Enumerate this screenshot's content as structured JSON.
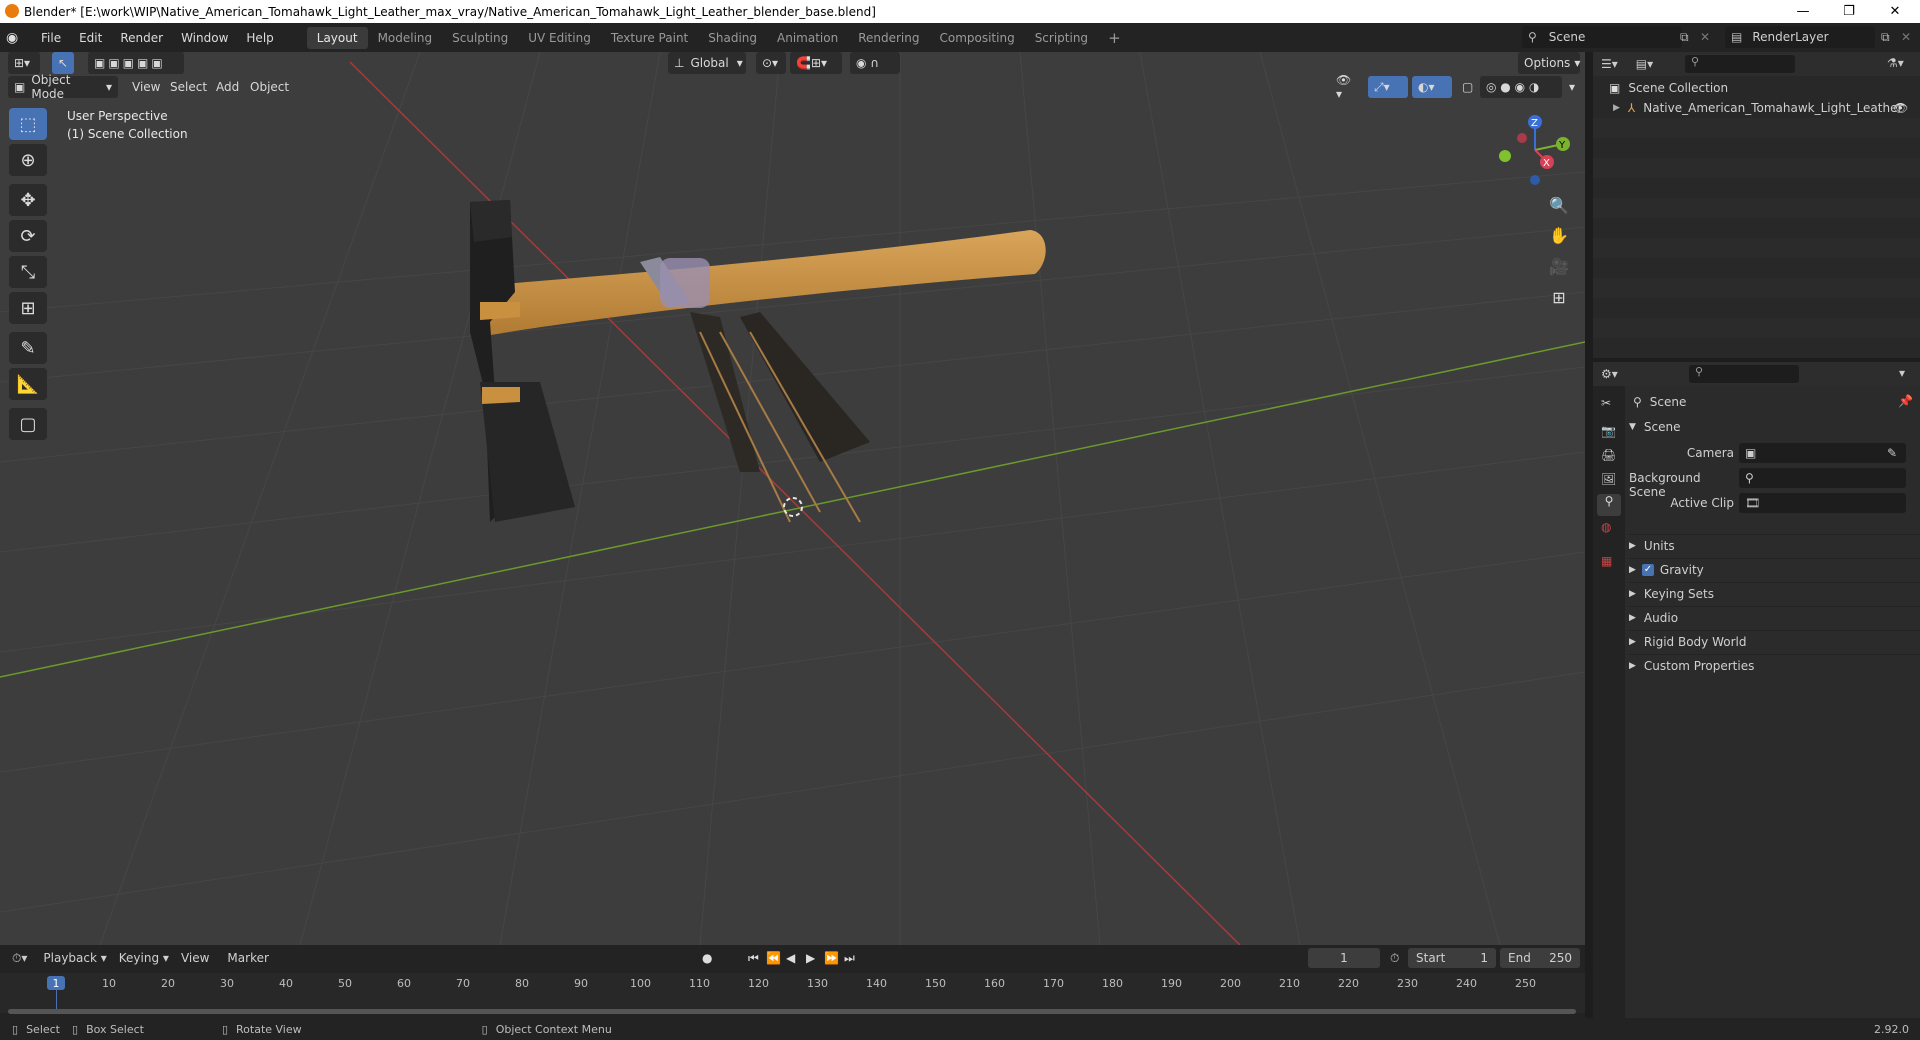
{
  "window": {
    "title": "Blender* [E:\\work\\WIP\\Native_American_Tomahawk_Light_Leather_max_vray/Native_American_Tomahawk_Light_Leather_blender_base.blend]",
    "minimize": "—",
    "maximize": "❐",
    "close": "✕"
  },
  "menubar": {
    "items": [
      "File",
      "Edit",
      "Render",
      "Window",
      "Help"
    ],
    "workspaces": [
      "Layout",
      "Modeling",
      "Sculpting",
      "UV Editing",
      "Texture Paint",
      "Shading",
      "Animation",
      "Rendering",
      "Compositing",
      "Scripting"
    ],
    "active_workspace": "Layout",
    "add_workspace": "+",
    "scene_label": "Scene",
    "renderlayer_label": "RenderLayer"
  },
  "viewport": {
    "transform_orientation": "Global",
    "options_label": "Options",
    "mode_label": "Object Mode",
    "header_menus": [
      "View",
      "Select",
      "Add",
      "Object"
    ],
    "overlay_line1": "User Perspective",
    "overlay_line2": "(1) Scene Collection",
    "gizmo": {
      "x": "X",
      "y": "Y",
      "z": "Z"
    }
  },
  "tools": [
    "select-box",
    "cursor",
    "move",
    "rotate",
    "scale",
    "transform",
    "annotate",
    "measure",
    "add-cube"
  ],
  "outliner": {
    "root": "Scene Collection",
    "items": [
      {
        "label": "Native_American_Tomahawk_Light_Leather",
        "visible": true
      }
    ]
  },
  "properties": {
    "context": "Scene",
    "panel_title": "Scene",
    "fields": [
      {
        "label": "Camera",
        "value": ""
      },
      {
        "label": "Background Scene",
        "value": ""
      },
      {
        "label": "Active Clip",
        "value": ""
      }
    ],
    "sections": [
      {
        "label": "Units",
        "checkbox": false
      },
      {
        "label": "Gravity",
        "checkbox": true
      },
      {
        "label": "Keying Sets",
        "checkbox": false
      },
      {
        "label": "Audio",
        "checkbox": false
      },
      {
        "label": "Rigid Body World",
        "checkbox": false
      },
      {
        "label": "Custom Properties",
        "checkbox": false
      }
    ]
  },
  "timeline": {
    "menus": [
      "Playback",
      "Keying",
      "View",
      "Marker"
    ],
    "current_frame": "1",
    "start_label": "Start",
    "start_value": "1",
    "end_label": "End",
    "end_value": "250",
    "ticks": [
      "1",
      "10",
      "20",
      "30",
      "40",
      "50",
      "60",
      "70",
      "80",
      "90",
      "100",
      "110",
      "120",
      "130",
      "140",
      "150",
      "160",
      "170",
      "180",
      "190",
      "200",
      "210",
      "220",
      "230",
      "240",
      "250"
    ]
  },
  "statusbar": {
    "hints": [
      "Select",
      "Box Select",
      "Rotate View",
      "Object Context Menu"
    ],
    "version": "2.92.0"
  },
  "colors": {
    "accent": "#4772b3",
    "x_axis": "#a83a3a",
    "y_axis": "#6b9a2c",
    "viewport_bg": "#3d3d3d"
  }
}
